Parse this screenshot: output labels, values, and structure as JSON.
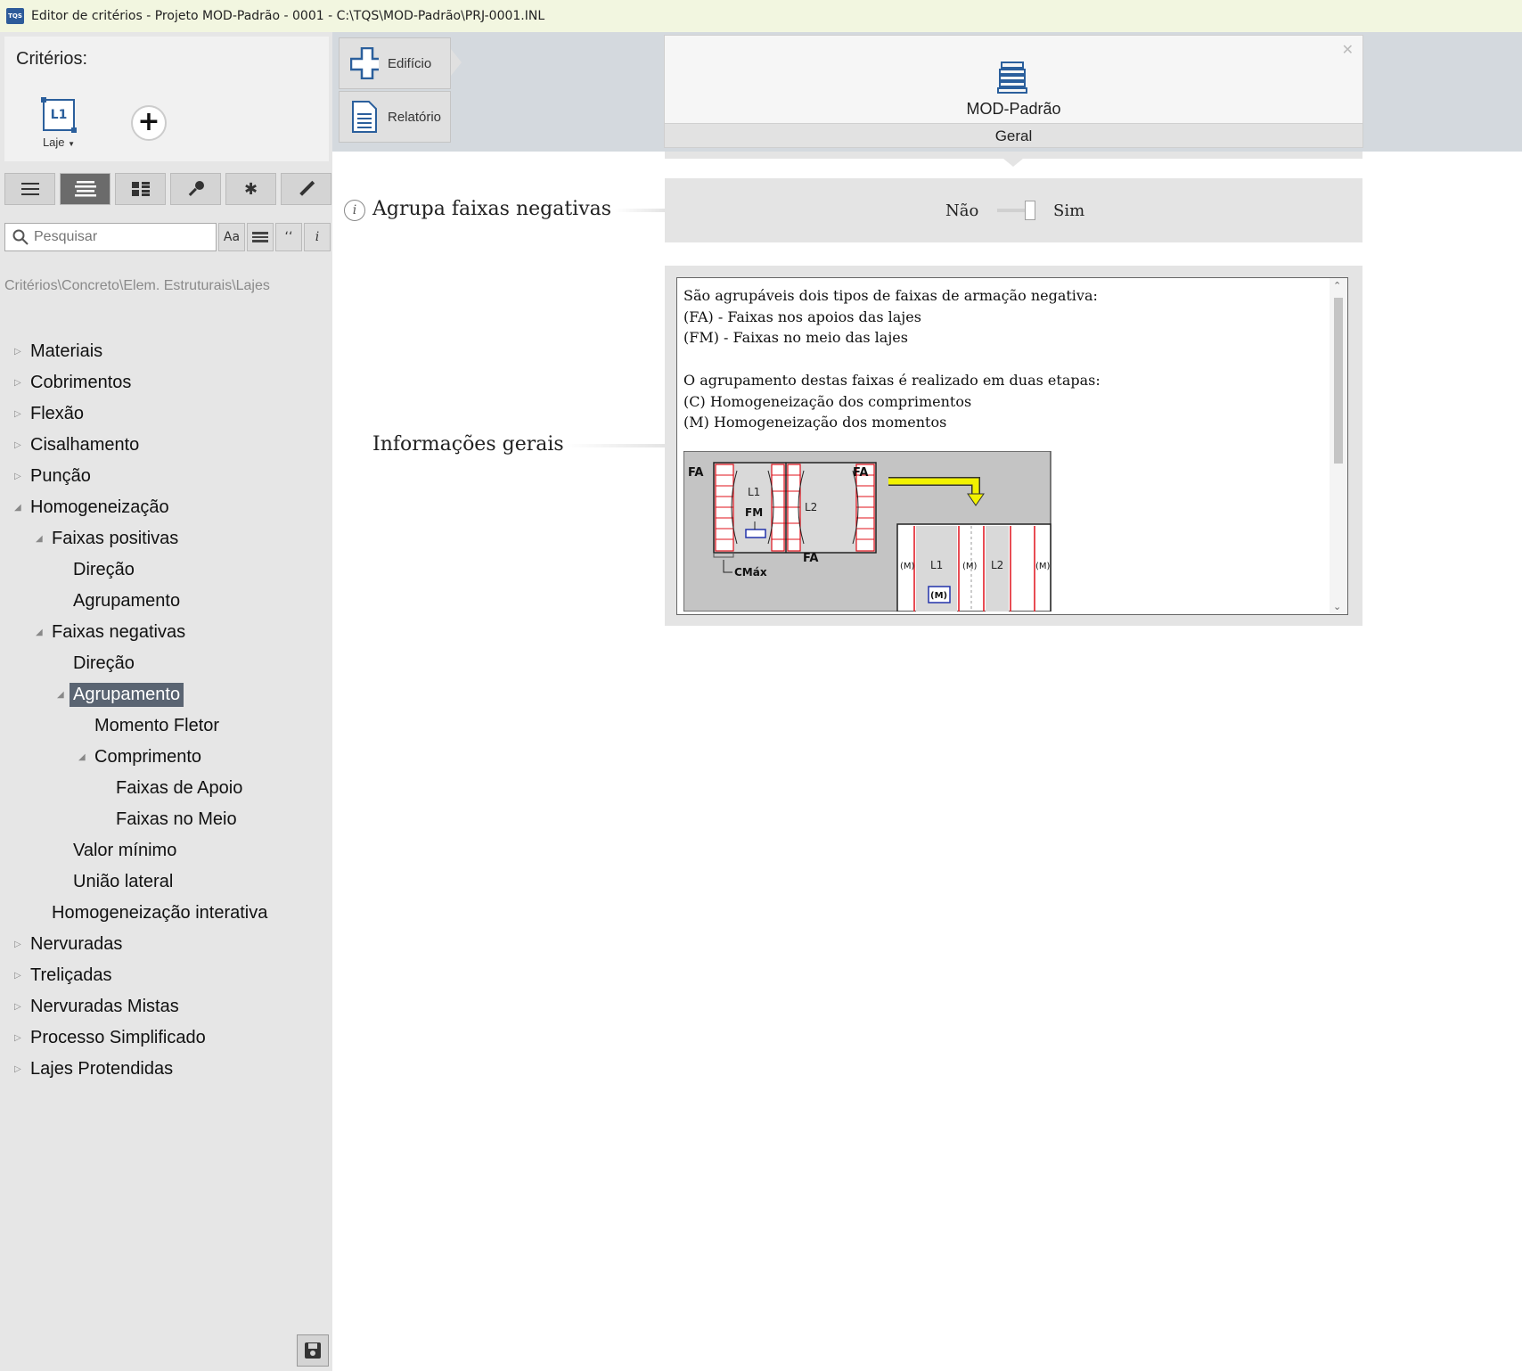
{
  "window": {
    "title": "Editor de critérios - Projeto MOD-Padrão - 0001 - C:\\TQS\\MOD-Padrão\\PRJ-0001.INL",
    "app_icon": "TQS"
  },
  "sidebar": {
    "criteria_title": "Critérios:",
    "laje_label": "Laje",
    "laje_icon_text": "L1",
    "view_buttons": [
      "list-view-icon",
      "indented-view-icon",
      "grid-view-icon",
      "key-icon",
      "asterisk-icon",
      "pencil-icon"
    ],
    "search": {
      "placeholder": "Pesquisar",
      "value": ""
    },
    "search_buttons": {
      "case": "Aa",
      "quote": "‘‘",
      "info": "i"
    },
    "breadcrumb": "Critérios\\Concreto\\Elem. Estruturais\\Lajes",
    "tree": [
      {
        "label": "Materiais",
        "level": 0,
        "arrow": "collapsed"
      },
      {
        "label": "Cobrimentos",
        "level": 0,
        "arrow": "collapsed"
      },
      {
        "label": "Flexão",
        "level": 0,
        "arrow": "collapsed"
      },
      {
        "label": "Cisalhamento",
        "level": 0,
        "arrow": "collapsed"
      },
      {
        "label": "Punção",
        "level": 0,
        "arrow": "collapsed"
      },
      {
        "label": "Homogeneização",
        "level": 0,
        "arrow": "expanded"
      },
      {
        "label": "Faixas positivas",
        "level": 1,
        "arrow": "expanded"
      },
      {
        "label": "Direção",
        "level": 2,
        "arrow": "none"
      },
      {
        "label": "Agrupamento",
        "level": 2,
        "arrow": "none"
      },
      {
        "label": "Faixas negativas",
        "level": 1,
        "arrow": "expanded"
      },
      {
        "label": "Direção",
        "level": 2,
        "arrow": "none"
      },
      {
        "label": "Agrupamento",
        "level": 2,
        "arrow": "expanded",
        "selected": true
      },
      {
        "label": "Momento Fletor",
        "level": 3,
        "arrow": "none"
      },
      {
        "label": "Comprimento",
        "level": 3,
        "arrow": "expanded"
      },
      {
        "label": "Faixas de Apoio",
        "level": 4,
        "arrow": "none"
      },
      {
        "label": "Faixas no Meio",
        "level": 4,
        "arrow": "none"
      },
      {
        "label": "Valor mínimo",
        "level": 2,
        "arrow": "none"
      },
      {
        "label": "União lateral",
        "level": 2,
        "arrow": "none"
      },
      {
        "label": "Homogeneização interativa",
        "level": 1,
        "arrow": "none"
      },
      {
        "label": "Nervuradas",
        "level": 0,
        "arrow": "collapsed"
      },
      {
        "label": "Treliçadas",
        "level": 0,
        "arrow": "collapsed"
      },
      {
        "label": "Nervuradas Mistas",
        "level": 0,
        "arrow": "collapsed"
      },
      {
        "label": "Processo Simplificado",
        "level": 0,
        "arrow": "collapsed"
      },
      {
        "label": "Lajes Protendidas",
        "level": 0,
        "arrow": "collapsed"
      }
    ]
  },
  "toolbar": {
    "edificio_label": "Edifício",
    "relatorio_label": "Relatório"
  },
  "building": {
    "name": "MOD-Padrão",
    "tab": "Geral",
    "close": "✕"
  },
  "criterion": {
    "label": "Agrupa faixas negativas",
    "toggle": {
      "off_label": "Não",
      "on_label": "Sim",
      "value": "Não"
    }
  },
  "general_info": {
    "label": "Informações gerais",
    "lines": [
      "São agrupáveis dois tipos de faixas de armação negativa:",
      "(FA) - Faixas nos apoios das lajes",
      "(FM) - Faixas no meio das lajes",
      "",
      "O agrupamento destas faixas é realizado em duas etapas:",
      "(C) Homogeneização dos comprimentos",
      "(M) Homogeneização dos momentos"
    ],
    "diagram_labels": {
      "fa": "FA",
      "fm": "FM",
      "l1": "L1",
      "l2": "L2",
      "cmax": "CMáx",
      "m": "(M)"
    }
  },
  "colors": {
    "selection": "#5a6472",
    "diagram_red": "#e0101a",
    "diagram_yellow": "#f2f200",
    "panel": "#e4e4e4"
  }
}
